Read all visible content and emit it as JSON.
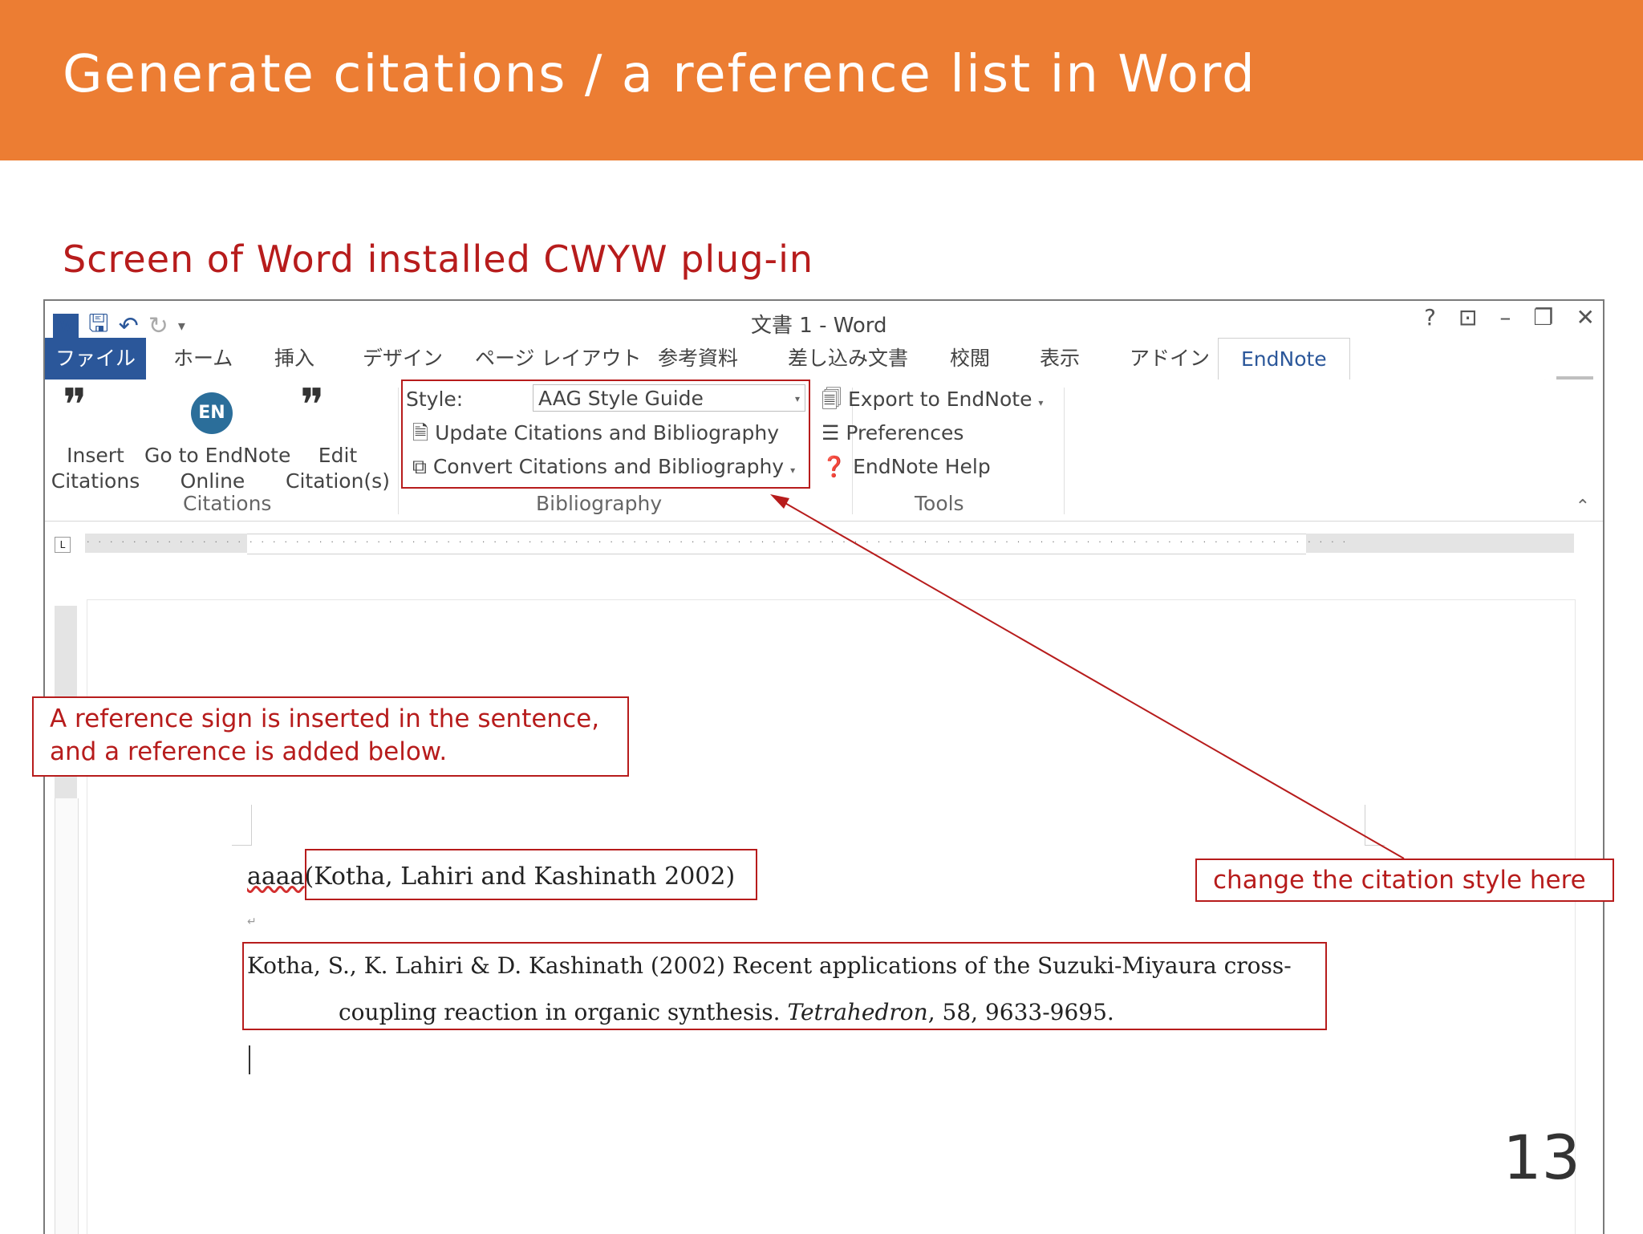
{
  "slide": {
    "title": "Generate citations / a reference list in Word",
    "subtitle": "Screen of Word installed CWYW plug-in",
    "page_number": "13",
    "accent_color": "#ec7d33",
    "annotation_color": "#b71c1c"
  },
  "word": {
    "window_title": "文書 1 - Word",
    "title_controls": [
      "?",
      "⊡",
      "–",
      "❐",
      "✕"
    ],
    "tabs": [
      "ファイル",
      "ホーム",
      "挿入",
      "デザイン",
      "ページ レイアウト",
      "参考資料",
      "差し込み文書",
      "校閲",
      "表示",
      "アドイン",
      "EndNote"
    ],
    "active_tab": "EndNote",
    "ribbon": {
      "citations_group": {
        "label": "Citations",
        "insert_line1": "Insert",
        "insert_line2": "Citations",
        "goto_line1": "Go to EndNote",
        "goto_line2": "Online",
        "goto_icon_text": "EN",
        "edit_line1": "Edit",
        "edit_line2": "Citation(s)"
      },
      "bibliography_group": {
        "label": "Bibliography",
        "style_label": "Style:",
        "style_value": "AAG Style Guide",
        "update": "Update Citations and Bibliography",
        "convert": "Convert Citations and Bibliography"
      },
      "tools_group": {
        "label": "Tools",
        "export": "Export to EndNote",
        "preferences": "Preferences",
        "help": "EndNote Help"
      }
    },
    "document": {
      "line_text": "aaaa",
      "citation": "(Kotha, Lahiri and Kashinath 2002)",
      "reference_line1": "Kotha, S., K. Lahiri & D. Kashinath (2002) Recent applications of the Suzuki-Miyaura cross-",
      "reference_line2_start": "coupling reaction in organic synthesis. ",
      "reference_journal": "Tetrahedron",
      "reference_line2_end": ", 58, 9633-9695."
    }
  },
  "annotations": {
    "left_line1": "A reference sign is inserted in the sentence,",
    "left_line2": "and a reference is added below.",
    "right": "change the citation style here"
  }
}
